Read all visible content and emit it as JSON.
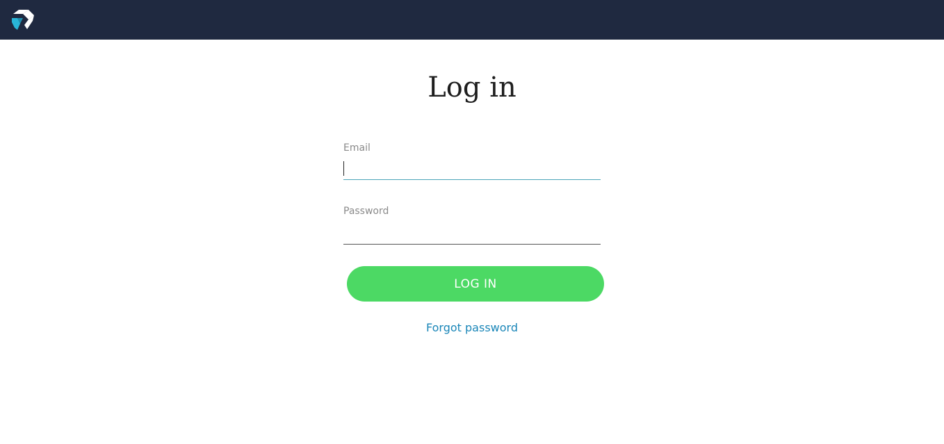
{
  "header": {
    "logo_icon": "brand-logo-icon",
    "background_color": "#1f2940"
  },
  "main": {
    "title": "Log in",
    "email": {
      "label": "Email",
      "value": "",
      "placeholder": ""
    },
    "password": {
      "label": "Password",
      "value": "",
      "placeholder": ""
    },
    "login_button": {
      "label": "LOG IN",
      "color": "#4cd964"
    },
    "forgot_password": {
      "label": "Forgot password",
      "color": "#1a86b8"
    }
  }
}
